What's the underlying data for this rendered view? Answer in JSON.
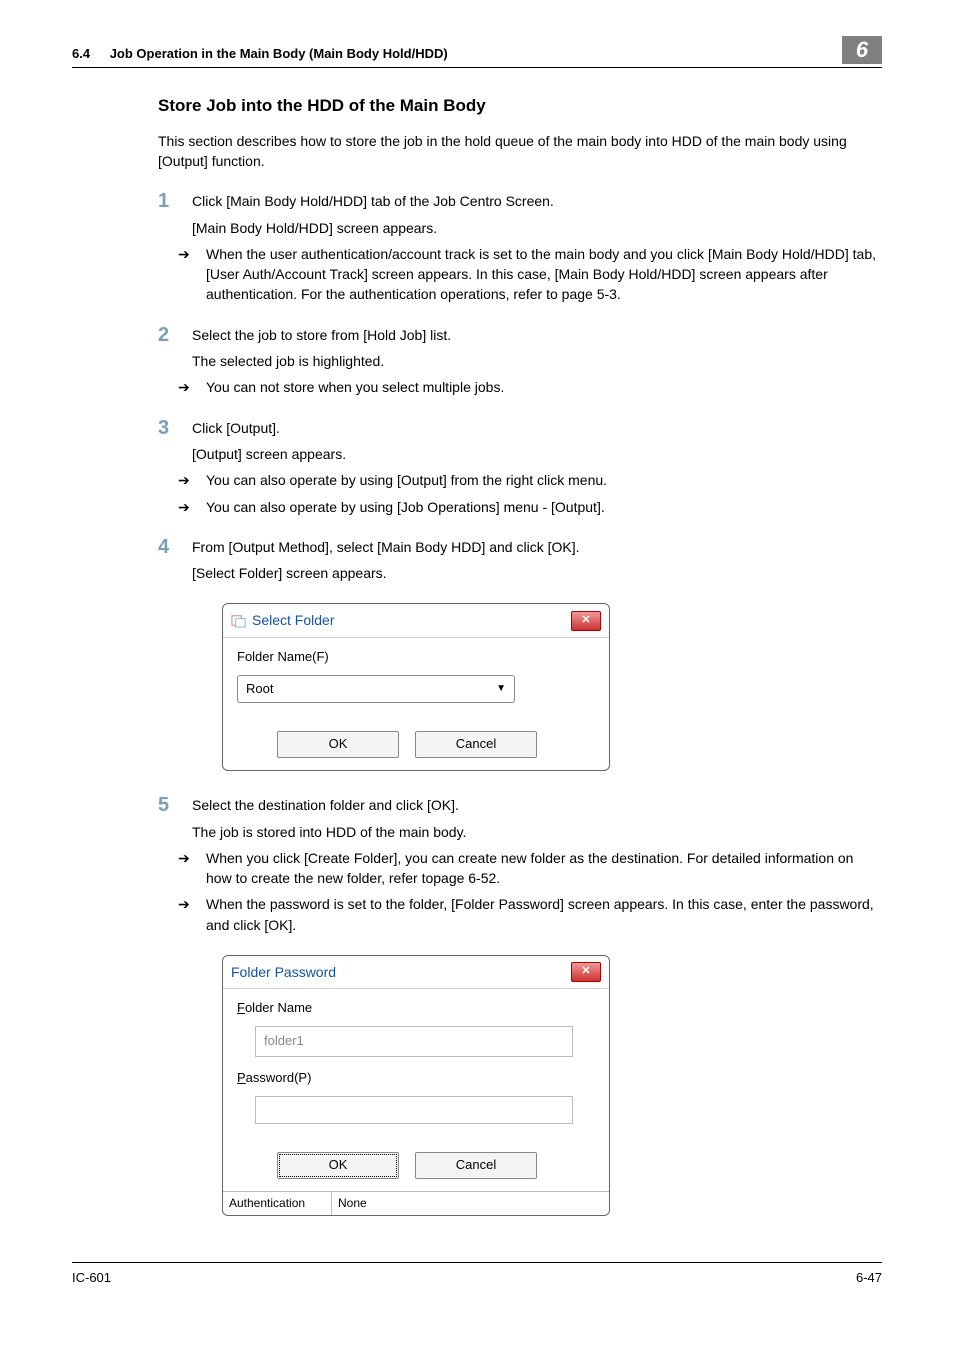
{
  "header": {
    "section_number": "6.4",
    "section_title": "Job Operation in the Main Body (Main Body Hold/HDD)",
    "chapter": "6"
  },
  "heading": "Store Job into the HDD of the Main Body",
  "intro": "This section describes how to store the job in the hold queue of the main body into HDD of the main body using [Output] function.",
  "steps": [
    {
      "n": "1",
      "first": "Click [Main Body Hold/HDD] tab of the Job Centro Screen.",
      "sub": "[Main Body Hold/HDD] screen appears.",
      "arrows": [
        "When the user authentication/account track is set to the main body and you click [Main Body Hold/HDD] tab, [User Auth/Account Track] screen appears. In this case, [Main Body Hold/HDD] screen appears after authentication. For the authentication operations, refer to page 5-3."
      ]
    },
    {
      "n": "2",
      "first": "Select the job to store from [Hold Job] list.",
      "sub": "The selected job is highlighted.",
      "arrows": [
        "You can not store when you select multiple jobs."
      ]
    },
    {
      "n": "3",
      "first": "Click [Output].",
      "sub": "[Output] screen appears.",
      "arrows": [
        "You can also operate by using [Output] from the right click menu.",
        "You can also operate by using [Job Operations] menu - [Output]."
      ]
    },
    {
      "n": "4",
      "first": "From [Output Method], select [Main Body HDD] and click [OK].",
      "sub": "[Select Folder] screen appears."
    },
    {
      "n": "5",
      "first": "Select the destination folder and click [OK].",
      "sub": "The job is stored into HDD of the main body.",
      "arrows": [
        "When you click [Create Folder], you can create new folder as the destination. For detailed information on how to create the new folder, refer topage 6-52.",
        "When the password is set to the folder, [Folder Password] screen appears. In this case, enter the password, and click [OK]."
      ]
    }
  ],
  "dialog1": {
    "title": "Select Folder",
    "label": "Folder Name(F)",
    "combo_value": "Root",
    "ok": "OK",
    "cancel": "Cancel"
  },
  "dialog2": {
    "title": "Folder Password",
    "label_folder_pre": "F",
    "label_folder_post": "older Name",
    "folder_value": "folder1",
    "label_pw_pre": "P",
    "label_pw_post": "assword(P)",
    "ok": "OK",
    "cancel": "Cancel",
    "auth_label": "Authentication",
    "auth_value": "None"
  },
  "footer": {
    "model": "IC-601",
    "page": "6-47"
  }
}
